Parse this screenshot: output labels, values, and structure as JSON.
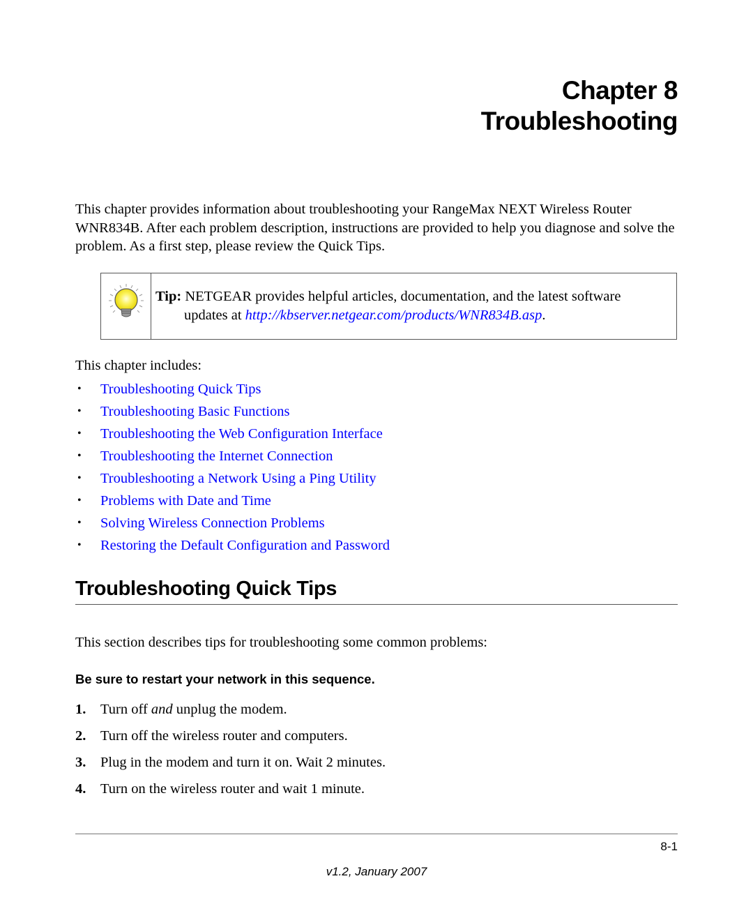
{
  "chapter": {
    "label": "Chapter 8",
    "title": "Troubleshooting"
  },
  "intro": {
    "text": "This chapter provides information about troubleshooting your RangeMax NEXT Wireless Router WNR834B. After each problem description, instructions are provided to help you diagnose and solve the problem. As a first step, please review the Quick Tips."
  },
  "tip": {
    "icon": "lightbulb-icon",
    "label": "Tip:",
    "text_line1": " NETGEAR provides helpful articles, documentation, and the latest software",
    "text_prefix": "updates at ",
    "url": "http://kbserver.netgear.com/products/WNR834B.asp",
    "text_suffix": "."
  },
  "includes": {
    "label": "This chapter includes:",
    "bullet": "•",
    "items": [
      {
        "label": "Troubleshooting Quick Tips"
      },
      {
        "label": "Troubleshooting Basic Functions"
      },
      {
        "label": "Troubleshooting the Web Configuration Interface"
      },
      {
        "label": "Troubleshooting the Internet Connection"
      },
      {
        "label": "Troubleshooting a Network Using a Ping Utility"
      },
      {
        "label": "Problems with Date and Time"
      },
      {
        "label": "Solving Wireless Connection Problems"
      },
      {
        "label": "Restoring the Default Configuration and Password"
      }
    ],
    "link_color": "#0000ff"
  },
  "section": {
    "heading": "Troubleshooting Quick Tips",
    "description": "This section describes tips for troubleshooting some common problems:",
    "subheading": "Be sure to restart your network in this sequence.",
    "steps": [
      {
        "num": "1.",
        "pre": "Turn off ",
        "em": "and",
        "post": " unplug the modem."
      },
      {
        "num": "2.",
        "pre": "Turn off the wireless router and computers.",
        "em": "",
        "post": ""
      },
      {
        "num": "3.",
        "pre": "Plug in the modem and turn it on. Wait 2 minutes.",
        "em": "",
        "post": ""
      },
      {
        "num": "4.",
        "pre": "Turn on the wireless router and wait 1 minute.",
        "em": "",
        "post": ""
      }
    ]
  },
  "footer": {
    "page_number": "8-1",
    "version": "v1.2, January 2007"
  }
}
